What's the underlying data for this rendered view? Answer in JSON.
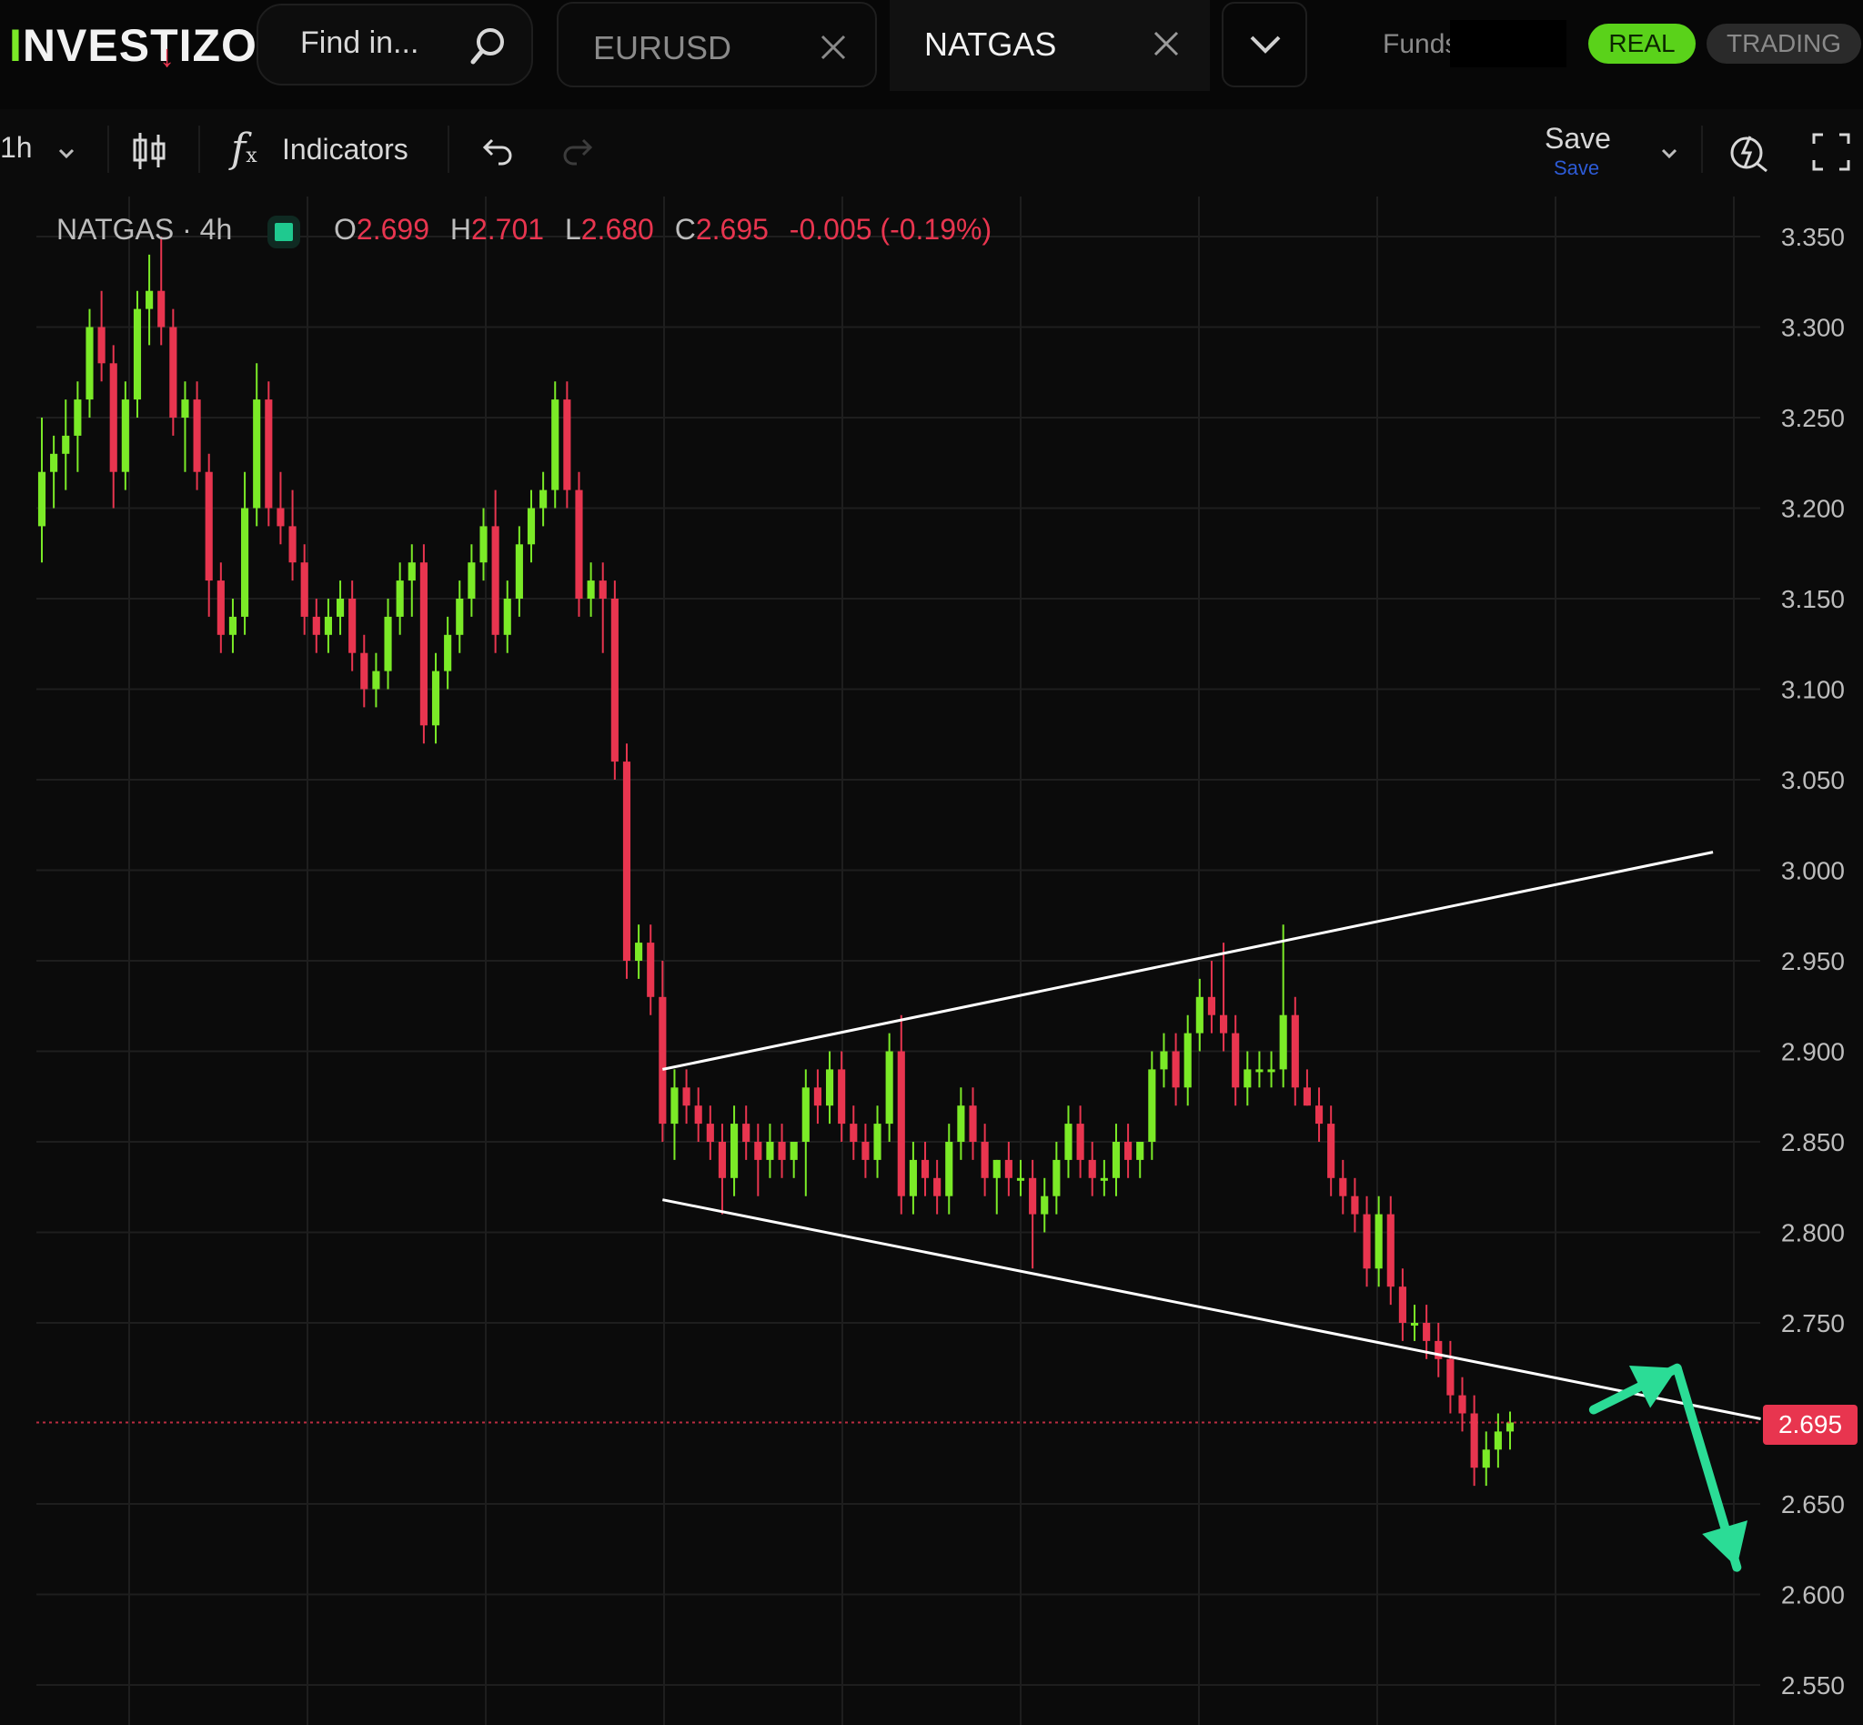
{
  "header": {
    "logo_text": "NVESTIZO",
    "logo_mark": "I",
    "search_placeholder": "Find in...",
    "tabs": [
      {
        "label": "EURUSD",
        "active": false
      },
      {
        "label": "NATGAS",
        "active": true
      }
    ],
    "funds_label": "Funds",
    "real_label": "REAL",
    "trading_label": "TRADING"
  },
  "toolbar": {
    "timeframe": "1h",
    "indicators_label": "Indicators",
    "save_label": "Save",
    "save_sub": "Save"
  },
  "legend": {
    "symbol": "NATGAS · 4h",
    "o_key": "O",
    "o": "2.699",
    "h_key": "H",
    "h": "2.701",
    "l_key": "L",
    "l": "2.680",
    "c_key": "C",
    "c": "2.695",
    "change": "-0.005 (-0.19%)"
  },
  "colors": {
    "up": "#7bea27",
    "down": "#e8354f",
    "grid": "#1e1e1e",
    "trendline": "#ffffff",
    "arrow": "#2bdc96"
  },
  "chart_data": {
    "type": "candlestick",
    "symbol": "NATGAS",
    "timeframe": "4h",
    "last_price": "2.695",
    "y_ticks": [
      "3.350",
      "3.300",
      "3.250",
      "3.200",
      "3.150",
      "3.100",
      "3.050",
      "3.000",
      "2.950",
      "2.900",
      "2.850",
      "2.800",
      "2.750",
      "2.650",
      "2.600",
      "2.550"
    ],
    "ylim": [
      2.53,
      3.365
    ],
    "grid": true,
    "bars_ohlc": [
      [
        3.19,
        3.25,
        3.17,
        3.22
      ],
      [
        3.22,
        3.24,
        3.2,
        3.23
      ],
      [
        3.23,
        3.26,
        3.21,
        3.24
      ],
      [
        3.24,
        3.27,
        3.22,
        3.26
      ],
      [
        3.26,
        3.31,
        3.25,
        3.3
      ],
      [
        3.3,
        3.32,
        3.27,
        3.28
      ],
      [
        3.28,
        3.29,
        3.2,
        3.22
      ],
      [
        3.22,
        3.27,
        3.21,
        3.26
      ],
      [
        3.26,
        3.32,
        3.25,
        3.31
      ],
      [
        3.31,
        3.34,
        3.29,
        3.32
      ],
      [
        3.32,
        3.35,
        3.29,
        3.3
      ],
      [
        3.3,
        3.31,
        3.24,
        3.25
      ],
      [
        3.25,
        3.27,
        3.22,
        3.26
      ],
      [
        3.26,
        3.27,
        3.21,
        3.22
      ],
      [
        3.22,
        3.23,
        3.14,
        3.16
      ],
      [
        3.16,
        3.17,
        3.12,
        3.13
      ],
      [
        3.13,
        3.15,
        3.12,
        3.14
      ],
      [
        3.14,
        3.22,
        3.13,
        3.2
      ],
      [
        3.2,
        3.28,
        3.19,
        3.26
      ],
      [
        3.26,
        3.27,
        3.19,
        3.2
      ],
      [
        3.2,
        3.22,
        3.18,
        3.19
      ],
      [
        3.19,
        3.21,
        3.16,
        3.17
      ],
      [
        3.17,
        3.18,
        3.13,
        3.14
      ],
      [
        3.14,
        3.15,
        3.12,
        3.13
      ],
      [
        3.13,
        3.15,
        3.12,
        3.14
      ],
      [
        3.14,
        3.16,
        3.13,
        3.15
      ],
      [
        3.15,
        3.16,
        3.11,
        3.12
      ],
      [
        3.12,
        3.13,
        3.09,
        3.1
      ],
      [
        3.1,
        3.12,
        3.09,
        3.11
      ],
      [
        3.11,
        3.15,
        3.1,
        3.14
      ],
      [
        3.14,
        3.17,
        3.13,
        3.16
      ],
      [
        3.16,
        3.18,
        3.14,
        3.17
      ],
      [
        3.17,
        3.18,
        3.07,
        3.08
      ],
      [
        3.08,
        3.12,
        3.07,
        3.11
      ],
      [
        3.11,
        3.14,
        3.1,
        3.13
      ],
      [
        3.13,
        3.16,
        3.12,
        3.15
      ],
      [
        3.15,
        3.18,
        3.14,
        3.17
      ],
      [
        3.17,
        3.2,
        3.16,
        3.19
      ],
      [
        3.19,
        3.21,
        3.12,
        3.13
      ],
      [
        3.13,
        3.16,
        3.12,
        3.15
      ],
      [
        3.15,
        3.19,
        3.14,
        3.18
      ],
      [
        3.18,
        3.21,
        3.17,
        3.2
      ],
      [
        3.2,
        3.22,
        3.19,
        3.21
      ],
      [
        3.21,
        3.27,
        3.2,
        3.26
      ],
      [
        3.26,
        3.27,
        3.2,
        3.21
      ],
      [
        3.21,
        3.22,
        3.14,
        3.15
      ],
      [
        3.15,
        3.17,
        3.14,
        3.16
      ],
      [
        3.16,
        3.17,
        3.12,
        3.15
      ],
      [
        3.15,
        3.16,
        3.05,
        3.06
      ],
      [
        3.06,
        3.07,
        2.94,
        2.95
      ],
      [
        2.95,
        2.97,
        2.94,
        2.96
      ],
      [
        2.96,
        2.97,
        2.92,
        2.93
      ],
      [
        2.93,
        2.95,
        2.85,
        2.86
      ],
      [
        2.86,
        2.89,
        2.84,
        2.88
      ],
      [
        2.88,
        2.89,
        2.86,
        2.87
      ],
      [
        2.87,
        2.88,
        2.85,
        2.86
      ],
      [
        2.86,
        2.87,
        2.84,
        2.85
      ],
      [
        2.85,
        2.86,
        2.81,
        2.83
      ],
      [
        2.83,
        2.87,
        2.82,
        2.86
      ],
      [
        2.86,
        2.87,
        2.84,
        2.85
      ],
      [
        2.85,
        2.86,
        2.82,
        2.84
      ],
      [
        2.84,
        2.86,
        2.83,
        2.85
      ],
      [
        2.85,
        2.86,
        2.83,
        2.84
      ],
      [
        2.84,
        2.85,
        2.83,
        2.85
      ],
      [
        2.85,
        2.89,
        2.82,
        2.88
      ],
      [
        2.88,
        2.89,
        2.86,
        2.87
      ],
      [
        2.87,
        2.9,
        2.86,
        2.89
      ],
      [
        2.89,
        2.9,
        2.85,
        2.86
      ],
      [
        2.86,
        2.87,
        2.84,
        2.85
      ],
      [
        2.85,
        2.86,
        2.83,
        2.84
      ],
      [
        2.84,
        2.87,
        2.83,
        2.86
      ],
      [
        2.86,
        2.91,
        2.85,
        2.9
      ],
      [
        2.9,
        2.92,
        2.81,
        2.82
      ],
      [
        2.82,
        2.85,
        2.81,
        2.84
      ],
      [
        2.84,
        2.85,
        2.82,
        2.83
      ],
      [
        2.83,
        2.84,
        2.81,
        2.82
      ],
      [
        2.82,
        2.86,
        2.81,
        2.85
      ],
      [
        2.85,
        2.88,
        2.84,
        2.87
      ],
      [
        2.87,
        2.88,
        2.84,
        2.85
      ],
      [
        2.85,
        2.86,
        2.82,
        2.83
      ],
      [
        2.83,
        2.84,
        2.81,
        2.84
      ],
      [
        2.84,
        2.85,
        2.82,
        2.83
      ],
      [
        2.83,
        2.84,
        2.82,
        2.83
      ],
      [
        2.83,
        2.84,
        2.78,
        2.81
      ],
      [
        2.81,
        2.83,
        2.8,
        2.82
      ],
      [
        2.82,
        2.85,
        2.81,
        2.84
      ],
      [
        2.84,
        2.87,
        2.83,
        2.86
      ],
      [
        2.86,
        2.87,
        2.83,
        2.84
      ],
      [
        2.84,
        2.85,
        2.82,
        2.83
      ],
      [
        2.83,
        2.84,
        2.82,
        2.83
      ],
      [
        2.83,
        2.86,
        2.82,
        2.85
      ],
      [
        2.85,
        2.86,
        2.83,
        2.84
      ],
      [
        2.84,
        2.85,
        2.83,
        2.85
      ],
      [
        2.85,
        2.9,
        2.84,
        2.89
      ],
      [
        2.89,
        2.91,
        2.88,
        2.9
      ],
      [
        2.9,
        2.91,
        2.87,
        2.88
      ],
      [
        2.88,
        2.92,
        2.87,
        2.91
      ],
      [
        2.91,
        2.94,
        2.9,
        2.93
      ],
      [
        2.93,
        2.95,
        2.91,
        2.92
      ],
      [
        2.92,
        2.96,
        2.9,
        2.91
      ],
      [
        2.91,
        2.92,
        2.87,
        2.88
      ],
      [
        2.88,
        2.9,
        2.87,
        2.89
      ],
      [
        2.89,
        2.9,
        2.88,
        2.89
      ],
      [
        2.89,
        2.9,
        2.88,
        2.89
      ],
      [
        2.89,
        2.97,
        2.88,
        2.92
      ],
      [
        2.92,
        2.93,
        2.87,
        2.88
      ],
      [
        2.88,
        2.89,
        2.87,
        2.87
      ],
      [
        2.87,
        2.88,
        2.85,
        2.86
      ],
      [
        2.86,
        2.87,
        2.82,
        2.83
      ],
      [
        2.83,
        2.84,
        2.81,
        2.82
      ],
      [
        2.82,
        2.83,
        2.8,
        2.81
      ],
      [
        2.81,
        2.82,
        2.77,
        2.78
      ],
      [
        2.78,
        2.82,
        2.77,
        2.81
      ],
      [
        2.81,
        2.82,
        2.76,
        2.77
      ],
      [
        2.77,
        2.78,
        2.74,
        2.75
      ],
      [
        2.75,
        2.76,
        2.74,
        2.75
      ],
      [
        2.75,
        2.76,
        2.73,
        2.74
      ],
      [
        2.74,
        2.75,
        2.72,
        2.73
      ],
      [
        2.73,
        2.74,
        2.7,
        2.71
      ],
      [
        2.71,
        2.72,
        2.69,
        2.7
      ],
      [
        2.7,
        2.71,
        2.66,
        2.67
      ],
      [
        2.67,
        2.69,
        2.66,
        2.68
      ],
      [
        2.68,
        2.7,
        2.67,
        2.69
      ],
      [
        2.69,
        2.701,
        2.68,
        2.695
      ]
    ],
    "trendlines": [
      {
        "from_bar": 52,
        "from_price": 2.89,
        "to_bar": 140,
        "to_price": 3.01
      },
      {
        "from_bar": 52,
        "from_price": 2.818,
        "to_bar": 144,
        "to_price": 2.697
      }
    ],
    "annotation_arrows": [
      {
        "from_bar": 130,
        "from_price": 2.702,
        "to_bar": 137,
        "to_price": 2.725
      },
      {
        "from_bar": 137,
        "from_price": 2.725,
        "to_bar": 142,
        "to_price": 2.615
      }
    ]
  }
}
